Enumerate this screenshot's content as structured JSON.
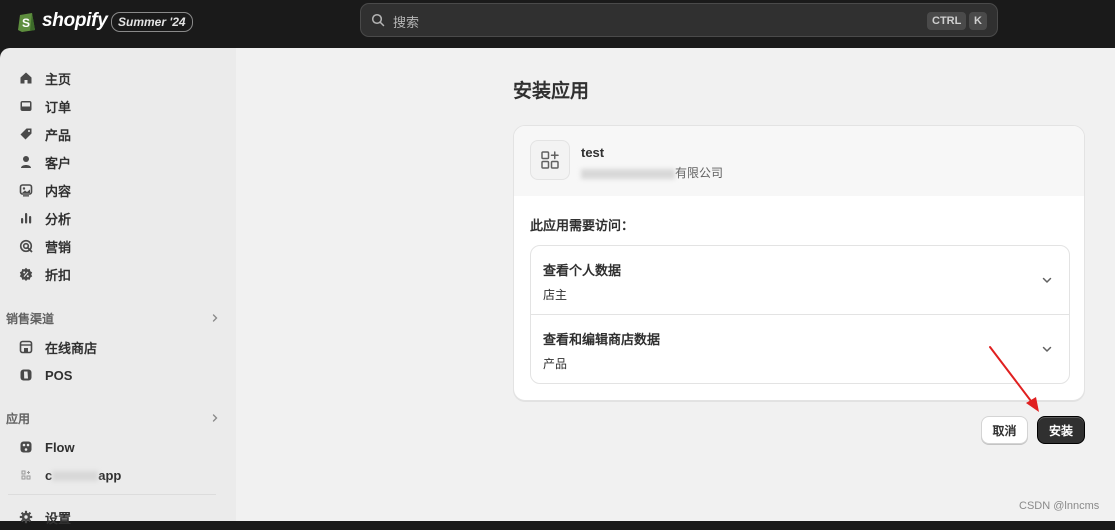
{
  "topbar": {
    "logo_text": "shopify",
    "edition_badge": "Summer '24",
    "search_placeholder": "搜索",
    "shortcut_ctrl": "CTRL",
    "shortcut_k": "K"
  },
  "sidebar": {
    "items": [
      {
        "label": "主页",
        "icon": "home-icon"
      },
      {
        "label": "订单",
        "icon": "inbox-icon"
      },
      {
        "label": "产品",
        "icon": "tag-icon"
      },
      {
        "label": "客户",
        "icon": "person-icon"
      },
      {
        "label": "内容",
        "icon": "image-icon"
      },
      {
        "label": "分析",
        "icon": "bar-chart-icon"
      },
      {
        "label": "营销",
        "icon": "target-icon"
      },
      {
        "label": "折扣",
        "icon": "discount-icon"
      }
    ],
    "sales_channels": {
      "heading": "销售渠道",
      "items": [
        {
          "label": "在线商店",
          "icon": "store-icon"
        },
        {
          "label": "POS",
          "icon": "pos-icon"
        }
      ]
    },
    "apps": {
      "heading": "应用",
      "items": [
        {
          "label": "Flow",
          "icon": "flow-icon"
        },
        {
          "label_start": "c",
          "label_end": "app",
          "icon": "app-icon"
        }
      ]
    },
    "settings_label": "设置"
  },
  "main": {
    "page_title": "安装应用",
    "app": {
      "name": "test",
      "company_tail": "有限公司"
    },
    "access_label": "此应用需要访问：",
    "permissions": [
      {
        "title": "查看个人数据",
        "subtitle": "店主"
      },
      {
        "title": "查看和编辑商店数据",
        "subtitle": "产品"
      }
    ],
    "cancel_label": "取消",
    "install_label": "安装"
  },
  "watermark": "CSDN @lnncms",
  "colors": {
    "topbar_bg": "#1a1a1a",
    "sidebar_bg": "#ebebeb",
    "main_bg": "#f1f1f1",
    "primary_button": "#303030",
    "annotation_arrow": "#e02020"
  }
}
